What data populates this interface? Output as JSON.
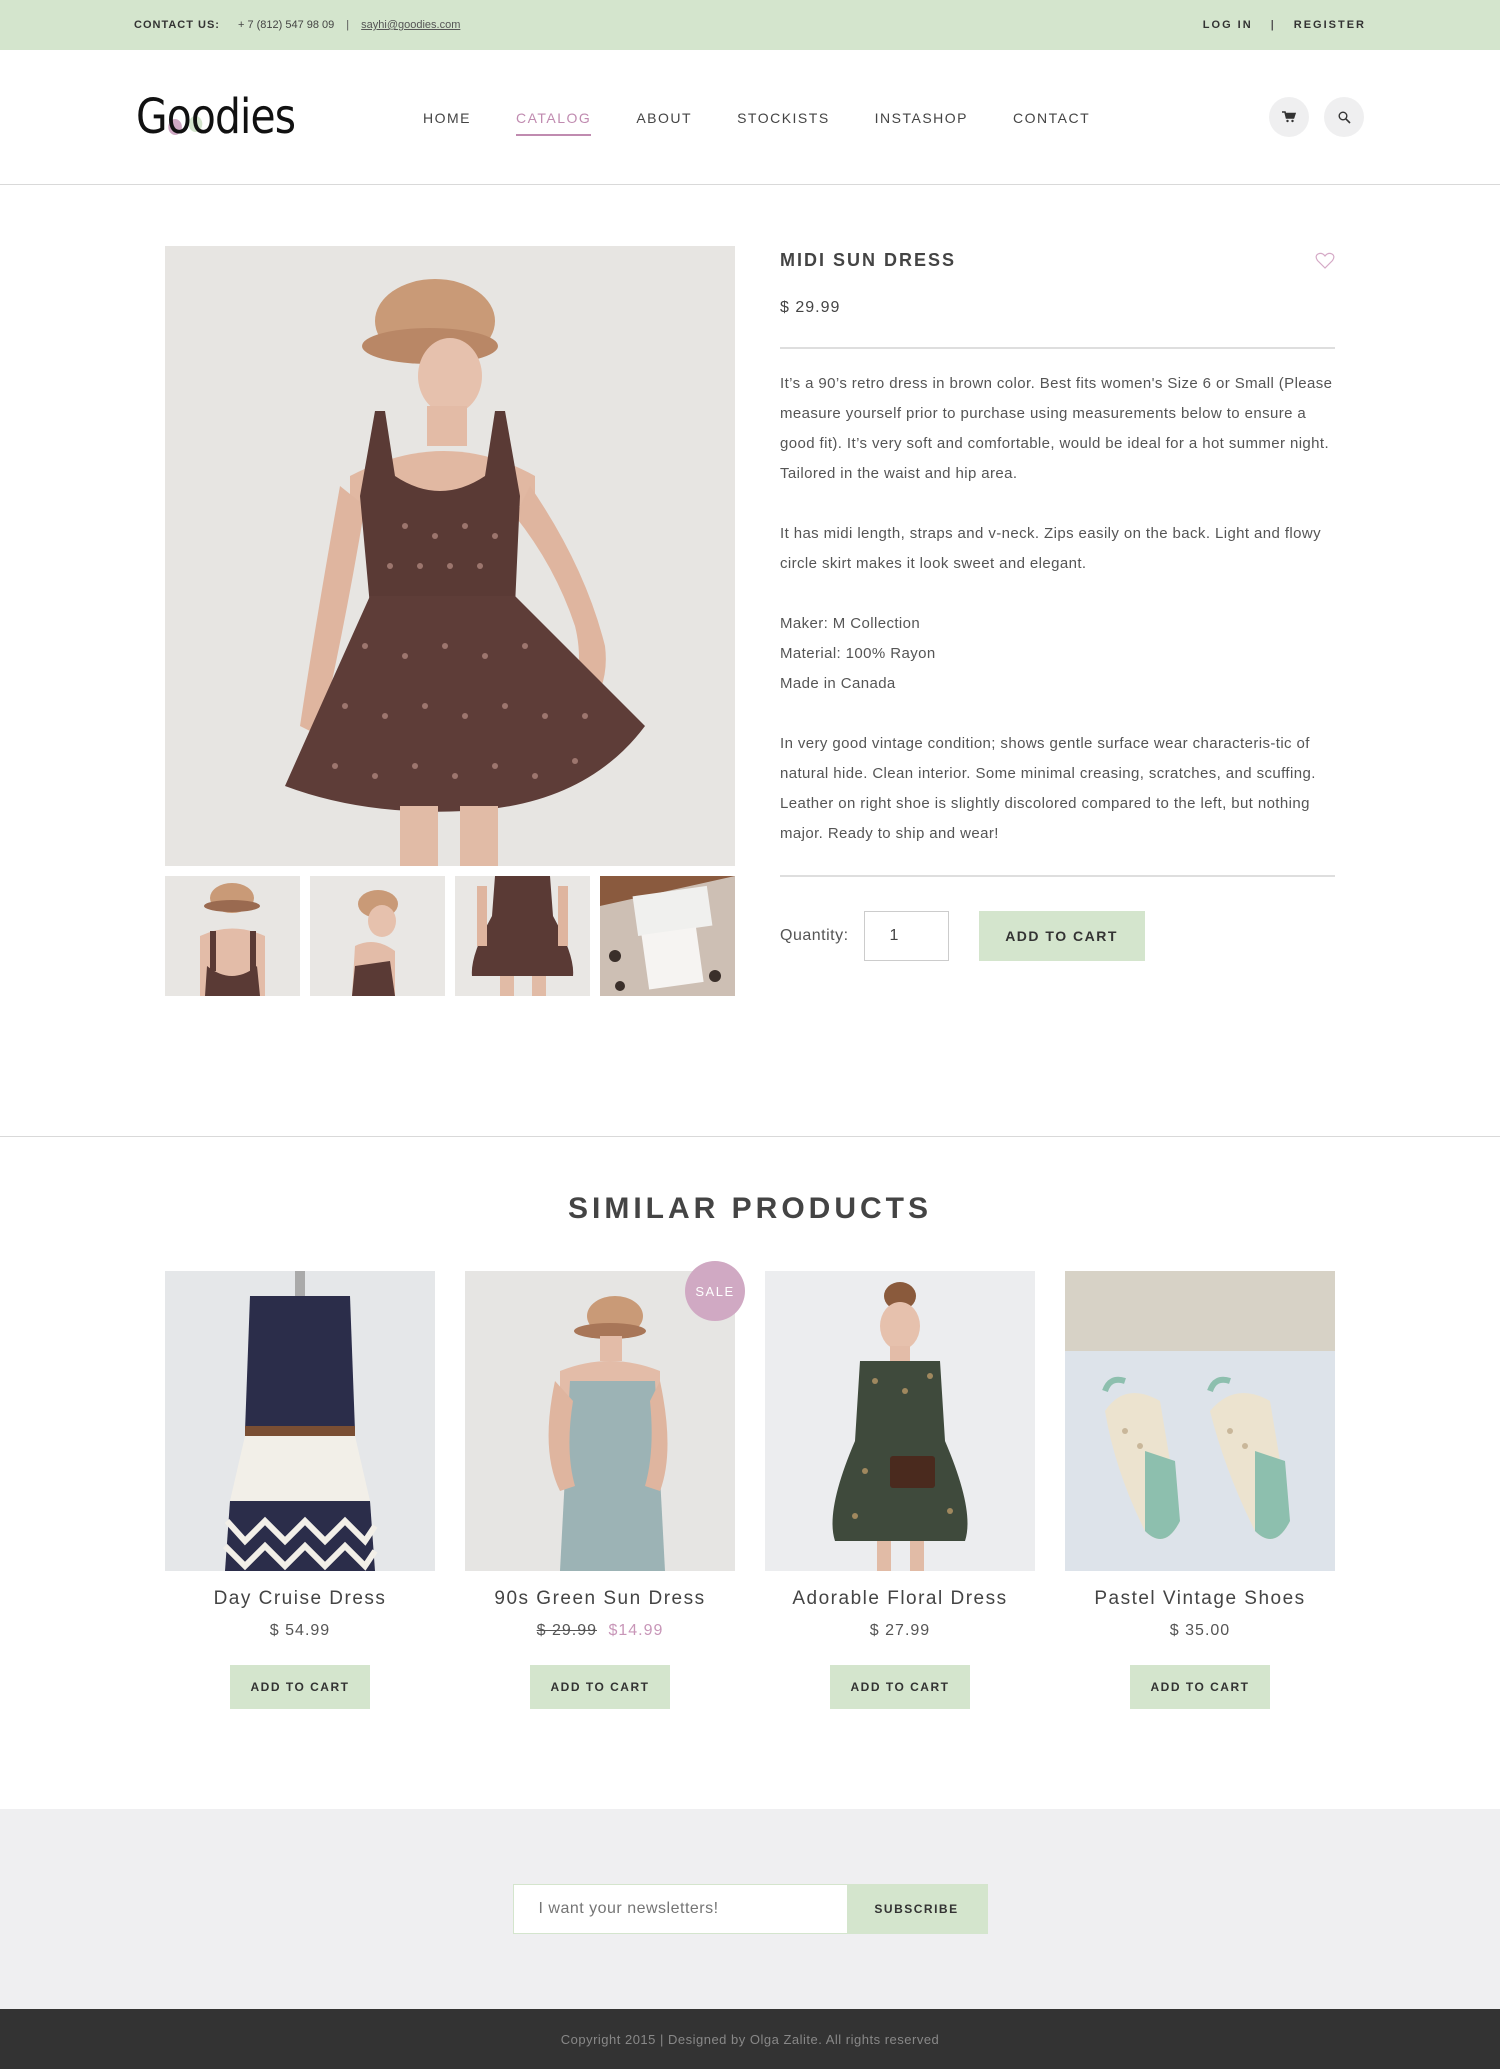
{
  "topbar": {
    "contact_label": "CONTACT US:",
    "phone": "+ 7 (812) 547 98 09",
    "separator": "|",
    "email": "sayhi@goodies.com",
    "login": "LOG IN",
    "register": "REGISTER"
  },
  "header": {
    "logo": "Goodies",
    "nav": [
      {
        "label": "HOME",
        "active": false
      },
      {
        "label": "CATALOG",
        "active": true
      },
      {
        "label": "ABOUT",
        "active": false
      },
      {
        "label": "STOCKISTS",
        "active": false
      },
      {
        "label": "INSTASHOP",
        "active": false
      },
      {
        "label": "CONTACT",
        "active": false
      }
    ],
    "icons": [
      "cart-icon",
      "search-icon"
    ]
  },
  "product": {
    "title": "MIDI SUN DRESS",
    "price": "$ 29.99",
    "description": [
      "It’s a 90’s retro dress in brown color. Best fits women's Size 6 or Small (Please measure yourself prior to purchase using measurements below to ensure a good fit). It’s very soft and comfortable, would be ideal for a hot summer night. Tailored in the waist and hip area.",
      "It has midi length, straps and v-neck. Zips easily on the back. Light and flowy circle skirt makes it look sweet and elegant.",
      "Maker: M Collection\nMaterial: 100% Rayon\nMade in Canada",
      "In very good vintage condition; shows gentle surface wear characteristic of natural hide. Clean interior. Some minimal creasing, scratches, and scuffing. Leather on right shoe is slightly discolored compared to the left, but nothing major. Ready to ship and wear!"
    ],
    "details": {
      "maker": "Maker: M Collection",
      "material": "Material: 100% Rayon",
      "origin": "Made in Canada"
    },
    "paragraphs": {
      "p1": "It’s a 90’s retro dress in brown color. Best fits women's Size 6 or Small (Please measure yourself prior to purchase using measurements below to ensure a good fit). It’s very soft and comfortable, would be ideal for a hot summer night. Tailored in the waist and hip area.",
      "p2": "It has midi length, straps and v-neck. Zips easily on the back. Light and flowy circle skirt makes it look sweet and elegant.",
      "p4": "In very good vintage condition; shows gentle surface wear characteris-tic of natural hide. Clean interior. Some minimal creasing, scratches, and scuffing. Leather on right shoe is slightly discolored compared to the left, but nothing major. Ready to ship and wear!"
    },
    "quantity_label": "Quantity:",
    "quantity_value": "1",
    "add_to_cart": "ADD TO CART",
    "thumbnails": [
      "back view",
      "side view",
      "skirt view",
      "M Collection label"
    ]
  },
  "similar": {
    "heading": "SIMILAR PRODUCTS",
    "items": [
      {
        "name": "Day Cruise Dress",
        "price": "$ 54.99",
        "button": "ADD TO CART"
      },
      {
        "name": "90s Green Sun Dress",
        "old_price": "$ 29.99",
        "price": "$14.99",
        "badge": "SALE",
        "button": "ADD TO CART"
      },
      {
        "name": "Adorable Floral Dress",
        "price": "$ 27.99",
        "button": "ADD TO CART"
      },
      {
        "name": "Pastel Vintage Shoes",
        "price": "$ 35.00",
        "button": "ADD TO CART"
      }
    ]
  },
  "newsletter": {
    "placeholder": "I want your newsletters!",
    "button": "SUBSCRIBE"
  },
  "footer": {
    "text": "Copyright 2015 | Designed by Olga Zalite. All rights reserved"
  },
  "colors": {
    "accent_green": "#d4e5cd",
    "accent_pink": "#c08bb0",
    "sale_badge": "#d0a9c3",
    "footer_bg": "#333333"
  }
}
